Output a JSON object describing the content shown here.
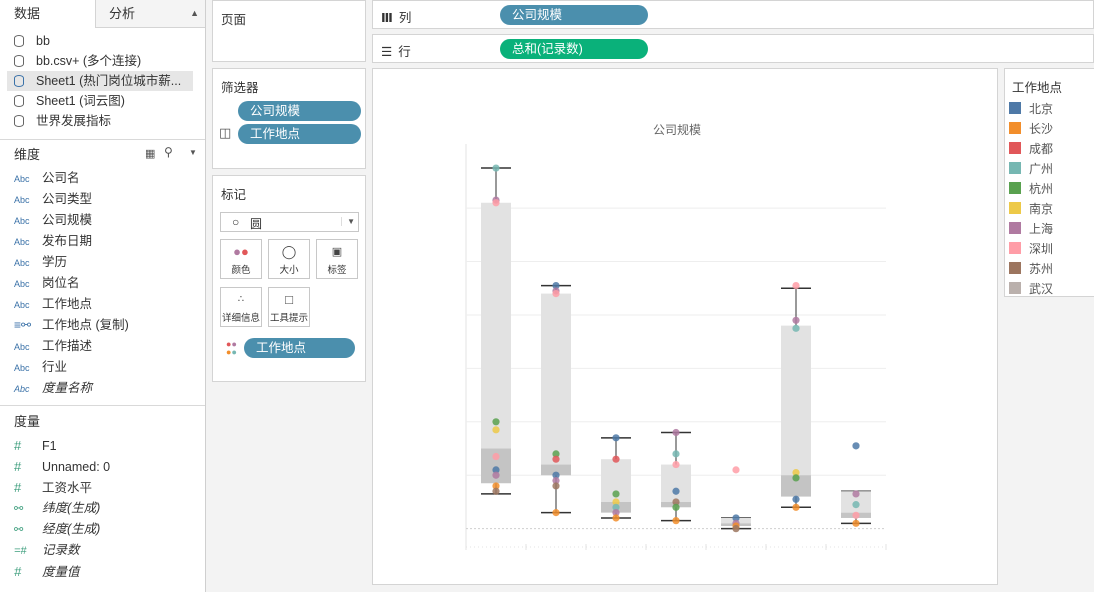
{
  "left_pane": {
    "tabs": {
      "data": "数据",
      "analysis": "分析",
      "sort_icon": "caret-icon"
    },
    "datasources": [
      {
        "label": "bb"
      },
      {
        "label": "bb.csv+ (多个连接)"
      },
      {
        "label": "Sheet1 (热门岗位城市薪..."
      },
      {
        "label": "Sheet1 (词云图)"
      },
      {
        "label": "世界发展指标"
      }
    ],
    "dimensions_title": "维度",
    "dimensions": [
      {
        "type": "Abc",
        "label": "公司名"
      },
      {
        "type": "Abc",
        "label": "公司类型"
      },
      {
        "type": "Abc",
        "label": "公司规模"
      },
      {
        "type": "Abc",
        "label": "发布日期"
      },
      {
        "type": "Abc",
        "label": "学历"
      },
      {
        "type": "Abc",
        "label": "岗位名"
      },
      {
        "type": "Abc",
        "label": "工作地点"
      },
      {
        "type": "globe",
        "label": "工作地点 (复制)"
      },
      {
        "type": "Abc",
        "label": "工作描述"
      },
      {
        "type": "Abc",
        "label": "行业"
      },
      {
        "type": "Abc",
        "label": "度量名称"
      }
    ],
    "measures_title": "度量",
    "measures": [
      {
        "type": "#",
        "label": "F1"
      },
      {
        "type": "#",
        "label": "Unnamed: 0"
      },
      {
        "type": "#",
        "label": "工资水平"
      },
      {
        "type": "globe",
        "label": "纬度(生成)"
      },
      {
        "type": "globe",
        "label": "经度(生成)"
      },
      {
        "type": "=#",
        "label": "记录数"
      },
      {
        "type": "#",
        "label": "度量值"
      }
    ]
  },
  "pages_shelf": {
    "title": "页面"
  },
  "filters_shelf": {
    "title": "筛选器",
    "pills": [
      "公司规模",
      "工作地点"
    ]
  },
  "marks_card": {
    "title": "标记",
    "mark_type": "圆",
    "buttons": {
      "color": "颜色",
      "size": "大小",
      "label": "标签",
      "detail": "详细信息",
      "tooltip": "工具提示"
    },
    "color_pill": "工作地点"
  },
  "columns_shelf": {
    "label": "列",
    "pill": "公司规模"
  },
  "rows_shelf": {
    "label": "行",
    "pill": "总和(记录数)"
  },
  "chart_data": {
    "type": "box-plot",
    "title": "公司规模",
    "categories": [
      "",
      "",
      "",
      "",
      "",
      "",
      ""
    ],
    "series_colors": {
      "北京": "#4e79a7",
      "长沙": "#f28e2b",
      "成都": "#e15759",
      "广州": "#76b7b2",
      "杭州": "#59a14f",
      "南京": "#edc948",
      "上海": "#b07aa1",
      "深圳": "#ff9da7",
      "苏州": "#9c755f",
      "武汉": "#bab0ac"
    },
    "boxes": [
      {
        "whisker_low": 6.5,
        "q1": 8.5,
        "median": 15.0,
        "q3": 61.0,
        "whisker_high": 67.5
      },
      {
        "whisker_low": 3.0,
        "q1": 10.0,
        "median": 12.0,
        "q3": 44.0,
        "whisker_high": 45.5
      },
      {
        "whisker_low": 2.0,
        "q1": 3.0,
        "median": 5.0,
        "q3": 13.0,
        "whisker_high": 17.0
      },
      {
        "whisker_low": 1.5,
        "q1": 4.0,
        "median": 5.0,
        "q3": 12.0,
        "whisker_high": 18.0
      },
      {
        "whisker_low": 0.0,
        "q1": 0.5,
        "median": 1.0,
        "q3": 2.0,
        "whisker_high": 2.0
      },
      {
        "whisker_low": 4.0,
        "q1": 6.0,
        "median": 10.0,
        "q3": 38.0,
        "whisker_high": 45.0
      },
      {
        "whisker_low": 1.0,
        "q1": 2.0,
        "median": 3.0,
        "q3": 7.0,
        "whisker_high": 7.0
      }
    ],
    "points": [
      {
        "col": 0,
        "city": "广州",
        "y": 67.5
      },
      {
        "col": 0,
        "city": "上海",
        "y": 61.5
      },
      {
        "col": 0,
        "city": "深圳",
        "y": 61.0
      },
      {
        "col": 0,
        "city": "杭州",
        "y": 20.0
      },
      {
        "col": 0,
        "city": "南京",
        "y": 18.5
      },
      {
        "col": 0,
        "city": "深圳",
        "y": 13.5
      },
      {
        "col": 0,
        "city": "北京",
        "y": 11.0
      },
      {
        "col": 0,
        "city": "上海",
        "y": 10.0
      },
      {
        "col": 0,
        "city": "长沙",
        "y": 8.0
      },
      {
        "col": 0,
        "city": "苏州",
        "y": 7.0
      },
      {
        "col": 1,
        "city": "北京",
        "y": 45.5
      },
      {
        "col": 1,
        "city": "上海",
        "y": 44.5
      },
      {
        "col": 1,
        "city": "深圳",
        "y": 44.0
      },
      {
        "col": 1,
        "city": "杭州",
        "y": 14.0
      },
      {
        "col": 1,
        "city": "成都",
        "y": 13.0
      },
      {
        "col": 1,
        "city": "北京",
        "y": 10.0
      },
      {
        "col": 1,
        "city": "上海",
        "y": 9.0
      },
      {
        "col": 1,
        "city": "苏州",
        "y": 8.0
      },
      {
        "col": 1,
        "city": "长沙",
        "y": 3.0
      },
      {
        "col": 2,
        "city": "北京",
        "y": 17.0
      },
      {
        "col": 2,
        "city": "成都",
        "y": 13.0
      },
      {
        "col": 2,
        "city": "杭州",
        "y": 6.5
      },
      {
        "col": 2,
        "city": "南京",
        "y": 5.0
      },
      {
        "col": 2,
        "city": "广州",
        "y": 4.0
      },
      {
        "col": 2,
        "city": "上海",
        "y": 3.0
      },
      {
        "col": 2,
        "city": "长沙",
        "y": 2.0
      },
      {
        "col": 3,
        "city": "上海",
        "y": 18.0
      },
      {
        "col": 3,
        "city": "广州",
        "y": 14.0
      },
      {
        "col": 3,
        "city": "深圳",
        "y": 12.0
      },
      {
        "col": 3,
        "city": "北京",
        "y": 7.0
      },
      {
        "col": 3,
        "city": "苏州",
        "y": 5.0
      },
      {
        "col": 3,
        "city": "杭州",
        "y": 4.0
      },
      {
        "col": 3,
        "city": "长沙",
        "y": 1.5
      },
      {
        "col": 4,
        "city": "深圳",
        "y": 11.0
      },
      {
        "col": 4,
        "city": "北京",
        "y": 2.0
      },
      {
        "col": 4,
        "city": "上海",
        "y": 1.0
      },
      {
        "col": 4,
        "city": "长沙",
        "y": 0.5
      },
      {
        "col": 4,
        "city": "苏州",
        "y": 0.0
      },
      {
        "col": 5,
        "city": "深圳",
        "y": 45.5
      },
      {
        "col": 5,
        "city": "上海",
        "y": 39.0
      },
      {
        "col": 5,
        "city": "广州",
        "y": 37.5
      },
      {
        "col": 5,
        "city": "南京",
        "y": 10.5
      },
      {
        "col": 5,
        "city": "杭州",
        "y": 9.5
      },
      {
        "col": 5,
        "city": "北京",
        "y": 5.5
      },
      {
        "col": 5,
        "city": "长沙",
        "y": 4.0
      },
      {
        "col": 6,
        "city": "北京",
        "y": 15.5
      },
      {
        "col": 6,
        "city": "上海",
        "y": 6.5
      },
      {
        "col": 6,
        "city": "广州",
        "y": 4.5
      },
      {
        "col": 6,
        "city": "深圳",
        "y": 2.5
      },
      {
        "col": 6,
        "city": "长沙",
        "y": 1.0
      }
    ],
    "ylim": [
      -1,
      72
    ]
  },
  "legend": {
    "title": "工作地点",
    "items": [
      {
        "label": "北京",
        "color": "#4e79a7"
      },
      {
        "label": "长沙",
        "color": "#f28e2b"
      },
      {
        "label": "成都",
        "color": "#e15759"
      },
      {
        "label": "广州",
        "color": "#76b7b2"
      },
      {
        "label": "杭州",
        "color": "#59a14f"
      },
      {
        "label": "南京",
        "color": "#edc948"
      },
      {
        "label": "上海",
        "color": "#b07aa1"
      },
      {
        "label": "深圳",
        "color": "#ff9da7"
      },
      {
        "label": "苏州",
        "color": "#9c755f"
      },
      {
        "label": "武汉",
        "color": "#bab0ac"
      }
    ]
  }
}
